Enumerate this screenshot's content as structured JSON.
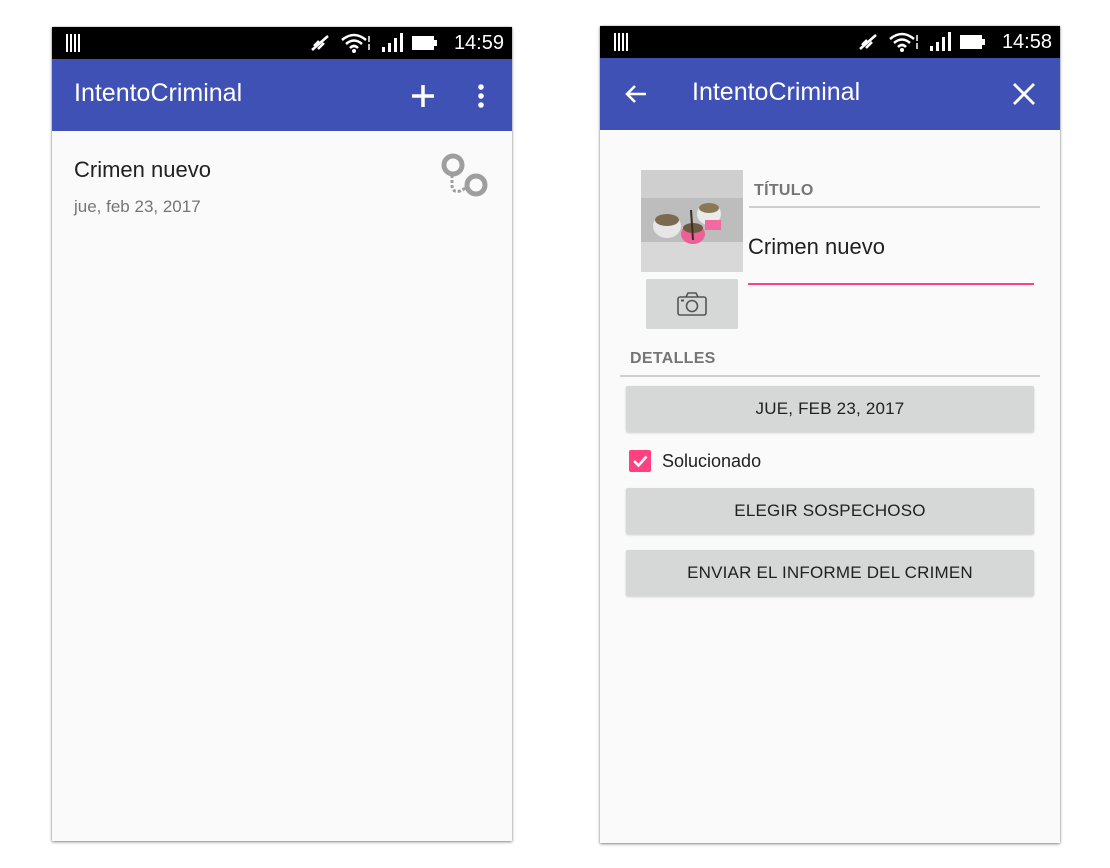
{
  "left_screen": {
    "status": {
      "time": "14:59"
    },
    "appbar": {
      "title": "IntentoCriminal",
      "add_icon": "plus-icon",
      "menu_icon": "overflow-menu-icon"
    },
    "list": [
      {
        "title": "Crimen nuevo",
        "date": "jue, feb 23, 2017",
        "solved_icon": "handcuffs-icon"
      }
    ]
  },
  "right_screen": {
    "status": {
      "time": "14:58"
    },
    "appbar": {
      "title": "IntentoCriminal",
      "back_icon": "back-arrow-icon",
      "close_icon": "close-icon"
    },
    "detail": {
      "title_label": "TÍTULO",
      "title_value": "Crimen nuevo",
      "camera_icon": "camera-icon",
      "details_label": "DETALLES",
      "date_button": "JUE, FEB 23, 2017",
      "solved_label": "Solucionado",
      "solved_checked": true,
      "suspect_button": "ELEGIR SOSPECHOSO",
      "report_button": "ENVIAR EL INFORME DEL CRIMEN"
    }
  },
  "colors": {
    "primary": "#3f51b5",
    "accent": "#ff4081",
    "background": "#fafafa",
    "button": "#d6d7d7"
  }
}
